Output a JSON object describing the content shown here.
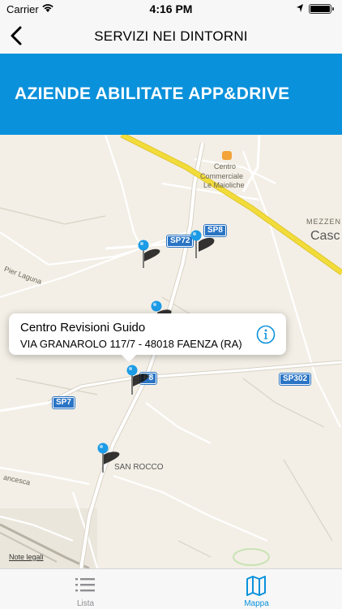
{
  "status_bar": {
    "carrier": "Carrier",
    "time": "4:16 PM"
  },
  "nav": {
    "title": "SERVIZI NEI DINTORNI"
  },
  "banner": {
    "text": "AZIENDE ABILITATE APP&DRIVE"
  },
  "map": {
    "labels": {
      "centro": "Centro",
      "commerciale": "Commerciale",
      "maioliche": "Le Maioliche",
      "mezzeno": "MEZZEN",
      "caso": "Casc",
      "pier_laguna": "Pier Laguna",
      "san_rocco": "SAN ROCCO",
      "fancesca": "ancesca"
    },
    "shields": {
      "sp72": "SP72",
      "sp8_top": "SP8",
      "sp8_mid": "P8",
      "sp302": "SP302",
      "sp7": "SP7"
    },
    "legal": "Note legali",
    "pin_color": "#1c9be6"
  },
  "callout": {
    "name": "Centro Revisioni Guido",
    "address": "VIA GRANAROLO 117/7 - 48018 FAENZA (RA)"
  },
  "tabs": {
    "lista": "Lista",
    "mappa": "Mappa"
  },
  "colors": {
    "accent": "#0a91db",
    "banner": "#0a91db",
    "road_major": "#f2dc3a"
  }
}
